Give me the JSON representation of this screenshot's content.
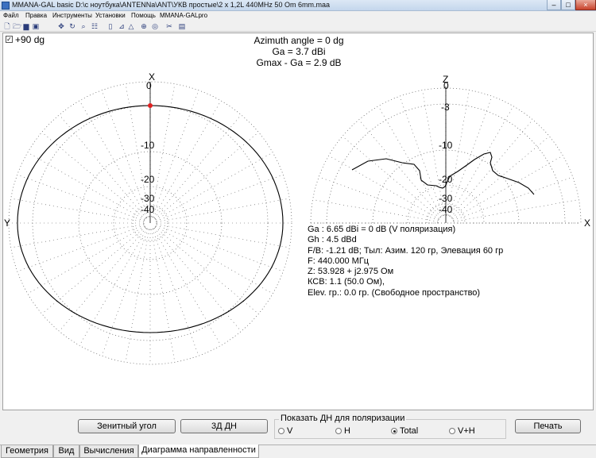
{
  "window": {
    "title": "MMANA-GAL basic D:\\с ноутбука\\ANTENNa\\ANT\\УКВ простые\\2 x 1,2L 440MHz 50 Om 6mm.maa",
    "minimize": "–",
    "maximize": "□",
    "close": "×"
  },
  "menu": [
    "Файл",
    "Правка",
    "Инструменты",
    "Установки",
    "Помощь",
    "MMANA-GALpro"
  ],
  "toolbar_icons": [
    "new-file-icon",
    "open-folder-icon",
    "save-icon",
    "save-as-icon",
    "move-icon",
    "rotate-icon",
    "zoom-icon",
    "grid-icon",
    "edit-icon",
    "chart-icon",
    "triangle-icon",
    "crosshair-icon",
    "target-icon",
    "tools-icon",
    "calculator-icon"
  ],
  "toolbar_glyphs": [
    "🗋",
    "🗁",
    "▆",
    "▣",
    "✥",
    "↻",
    "⌕",
    "☷",
    "▯",
    "⊿",
    "△",
    "⊕",
    "◎",
    "✂",
    "▤"
  ],
  "plot": {
    "checkbox_label": "+90 dg",
    "checkbox_checked": true,
    "azimuth": "Azimuth angle = 0 dg",
    "ga": "Ga = 3.7 dBi",
    "gmax": "Gmax - Ga = 2.9 dB",
    "left_axis_top": "X",
    "left_axis_left": "Y",
    "right_axis_top": "Z",
    "right_axis_right": "X",
    "left_rings": [
      "0",
      "-10",
      "-20",
      "-30",
      "-40"
    ],
    "right_rings": [
      "0",
      "-3",
      "-10",
      "-20",
      "-30",
      "-40"
    ]
  },
  "results": {
    "ga": "Ga : 6.65 dBi = 0 dB  (V поляризация)",
    "gh": "Gh : 4.5 dBd",
    "fb": "F/B: -1.21 dB; Тыл: Азим. 120 гр, Элевация 60 гр",
    "f": "F: 440.000 МГц",
    "z": "Z: 53.928 + j2.975 Ом",
    "swr": "КСВ: 1.1 (50.0 Ом),",
    "elev": "Elev. гр.: 0.0 гр. (Свободное пространство)"
  },
  "buttons": {
    "zenith": "Зенитный угол",
    "dn3d": "3Д   ДН",
    "print": "Печать"
  },
  "polarization": {
    "label": "Показать ДН для поляризации",
    "options": [
      "V",
      "H",
      "Total",
      "V+H"
    ],
    "selected": "Total"
  },
  "tabs": [
    "Геометрия",
    "Вид",
    "Вычисления",
    "Диаграмма направленности"
  ],
  "active_tab": "Диаграмма направленности",
  "colors": {
    "pattern": "#000000",
    "grid": "#555555",
    "marker": "#e02020",
    "accent": "#3a70c0"
  }
}
